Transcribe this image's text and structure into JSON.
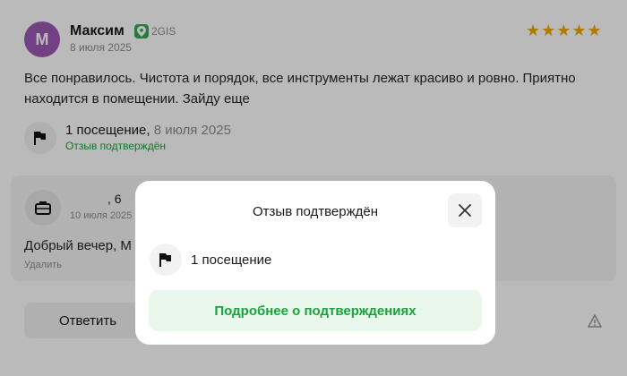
{
  "review": {
    "avatar_letter": "М",
    "author": "Максим",
    "source": "2GIS",
    "date": "8 июля 2025",
    "rating_stars": "★★★★★",
    "rating": 5,
    "text": "Все понравилось. Чистота и порядок, все инструменты лежат красиво и ровно. Приятно находится в помещении. Зайду еще",
    "visits": "1 посещение,",
    "visit_date": "8 июля 2025",
    "confirmed_label": "Отзыв подтверждён"
  },
  "reply": {
    "name": ", 6",
    "date": "10 июля 2025",
    "text": "Добрый вечер, М",
    "delete_label": "Удалить"
  },
  "actions": {
    "answer_label": "Ответить"
  },
  "modal": {
    "title": "Отзыв подтверждён",
    "visit_label": "1 посещение",
    "more_label": "Подробнее о подтверждениях"
  },
  "colors": {
    "accent_green": "#1aa33c",
    "star_gold": "#f2a900",
    "avatar_purple": "#9b59b6"
  }
}
